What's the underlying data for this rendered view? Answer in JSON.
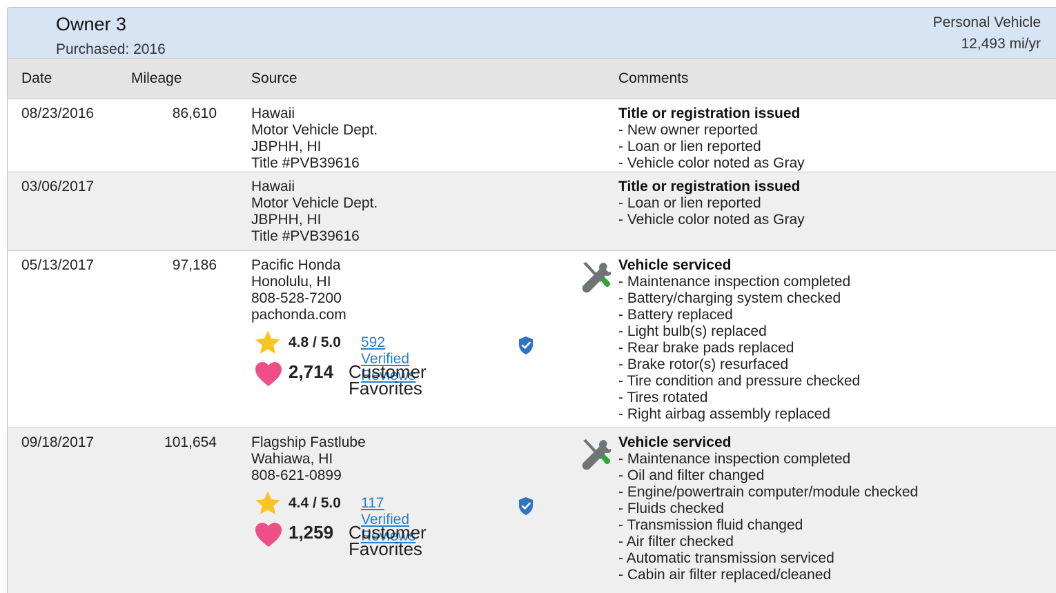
{
  "owner": {
    "title": "Owner 3",
    "purchased": "Purchased: 2016",
    "type": "Personal Vehicle",
    "miles_per_year": "12,493 mi/yr"
  },
  "columns": {
    "date": "Date",
    "mileage": "Mileage",
    "source": "Source",
    "comments": "Comments"
  },
  "rows": [
    {
      "date": "08/23/2016",
      "mileage": "86,610",
      "source": [
        "Hawaii",
        "Motor Vehicle Dept.",
        "JBPHH, HI",
        "Title #PVB39616"
      ],
      "comment_head": "Title or registration issued",
      "comments": [
        "- New owner reported",
        "- Loan or lien reported",
        "- Vehicle color noted as Gray"
      ]
    },
    {
      "date": "03/06/2017",
      "mileage": "",
      "source": [
        "Hawaii",
        "Motor Vehicle Dept.",
        "JBPHH, HI",
        "Title #PVB39616"
      ],
      "comment_head": "Title or registration issued",
      "comments": [
        "- Loan or lien reported",
        "- Vehicle color noted as Gray"
      ]
    },
    {
      "date": "05/13/2017",
      "mileage": "97,186",
      "source": [
        "Pacific Honda",
        "Honolulu, HI",
        "808-528-7200",
        "pachonda.com"
      ],
      "rating": "4.8 / 5.0",
      "reviews": "592 Verified Reviews",
      "favorites_count": "2,714",
      "favorites_label": "Customer Favorites",
      "comment_head": "Vehicle serviced",
      "comments": [
        "- Maintenance inspection completed",
        "- Battery/charging system checked",
        "- Battery replaced",
        "- Light bulb(s) replaced",
        "- Rear brake pads replaced",
        "- Brake rotor(s) resurfaced",
        "- Tire condition and pressure checked",
        "- Tires rotated",
        "- Right airbag assembly replaced"
      ]
    },
    {
      "date": "09/18/2017",
      "mileage": "101,654",
      "source": [
        "Flagship Fastlube",
        "Wahiawa, HI",
        "808-621-0899"
      ],
      "rating": "4.4 / 5.0",
      "reviews": "117 Verified Reviews",
      "favorites_count": "1,259",
      "favorites_label": "Customer Favorites",
      "comment_head": "Vehicle serviced",
      "comments": [
        "- Maintenance inspection completed",
        "- Oil and filter changed",
        "- Engine/powertrain computer/module checked",
        "- Fluids checked",
        "- Transmission fluid changed",
        "- Air filter checked",
        "- Automatic transmission serviced",
        "- Cabin air filter replaced/cleaned"
      ]
    }
  ],
  "icons": {
    "service": "wrench-screwdriver-icon",
    "star": "star-icon",
    "heart": "heart-icon",
    "verified": "verified-shield-icon"
  },
  "colors": {
    "header_bg": "#d6e4f4",
    "link": "#2a7fc9",
    "star": "#f7c51e",
    "heart": "#ef4f86",
    "alt_row": "#efefef"
  }
}
